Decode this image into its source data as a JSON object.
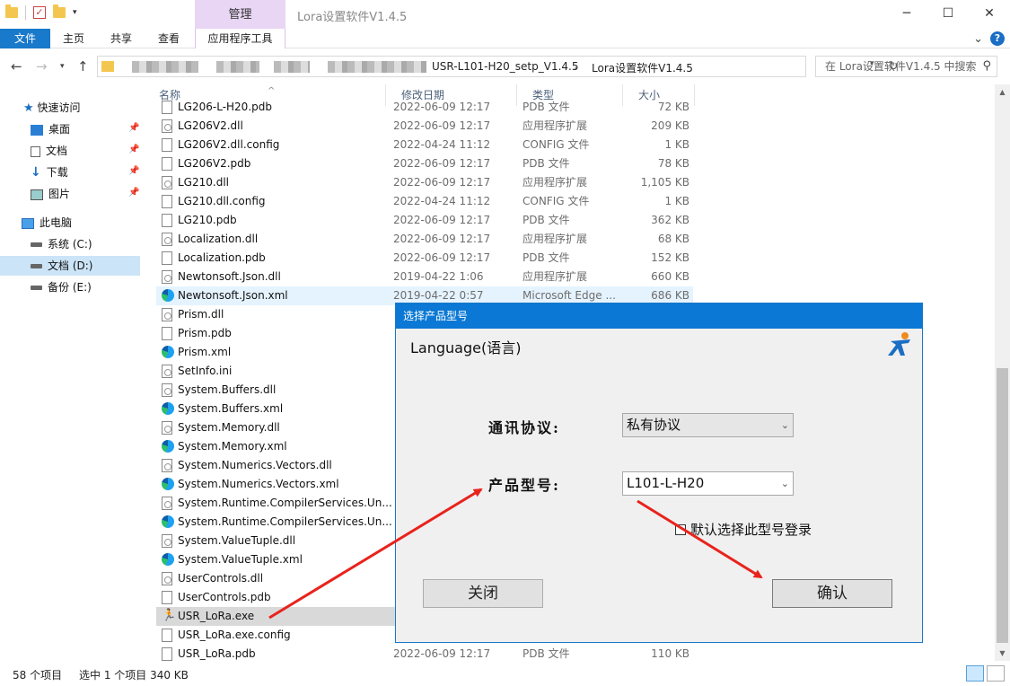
{
  "titlebar": {
    "manage_tab": "管理",
    "window_title": "Lora设置软件V1.4.5",
    "min": "─",
    "max": "☐",
    "close": "✕"
  },
  "ribbon": {
    "tabs": [
      "文件",
      "主页",
      "共享",
      "查看",
      "应用程序工具"
    ],
    "collapse": "⌄",
    "help": "?"
  },
  "address": {
    "crumbs": [
      "USR-L101-H20_setp_V1.4.5",
      "Lora设置软件V1.4.5"
    ],
    "sep": "›",
    "search_placeholder": "在 Lora设置软件V1.4.5 中搜索"
  },
  "nav": {
    "quick_access": "快速访问",
    "desktop": "桌面",
    "documents": "文档",
    "downloads": "下载",
    "pictures": "图片",
    "this_pc": "此电脑",
    "drive_c": "系统 (C:)",
    "drive_d": "文档 (D:)",
    "drive_e": "备份 (E:)"
  },
  "columns": {
    "name": "名称",
    "date": "修改日期",
    "type": "类型",
    "size": "大小"
  },
  "files": [
    {
      "name": "LG206-L-H20.pdb",
      "date": "2022-06-09 12:17",
      "type": "PDB 文件",
      "size": "72 KB",
      "icon": "doc"
    },
    {
      "name": "LG206V2.dll",
      "date": "2022-06-09 12:17",
      "type": "应用程序扩展",
      "size": "209 KB",
      "icon": "dll"
    },
    {
      "name": "LG206V2.dll.config",
      "date": "2022-04-24 11:12",
      "type": "CONFIG 文件",
      "size": "1 KB",
      "icon": "doc"
    },
    {
      "name": "LG206V2.pdb",
      "date": "2022-06-09 12:17",
      "type": "PDB 文件",
      "size": "78 KB",
      "icon": "doc"
    },
    {
      "name": "LG210.dll",
      "date": "2022-06-09 12:17",
      "type": "应用程序扩展",
      "size": "1,105 KB",
      "icon": "dll"
    },
    {
      "name": "LG210.dll.config",
      "date": "2022-04-24 11:12",
      "type": "CONFIG 文件",
      "size": "1 KB",
      "icon": "doc"
    },
    {
      "name": "LG210.pdb",
      "date": "2022-06-09 12:17",
      "type": "PDB 文件",
      "size": "362 KB",
      "icon": "doc"
    },
    {
      "name": "Localization.dll",
      "date": "2022-06-09 12:17",
      "type": "应用程序扩展",
      "size": "68 KB",
      "icon": "dll"
    },
    {
      "name": "Localization.pdb",
      "date": "2022-06-09 12:17",
      "type": "PDB 文件",
      "size": "152 KB",
      "icon": "doc"
    },
    {
      "name": "Newtonsoft.Json.dll",
      "date": "2019-04-22 1:06",
      "type": "应用程序扩展",
      "size": "660 KB",
      "icon": "dll"
    },
    {
      "name": "Newtonsoft.Json.xml",
      "date": "2019-04-22 0:57",
      "type": "Microsoft Edge ...",
      "size": "686 KB",
      "icon": "edge",
      "state": "hover"
    },
    {
      "name": "Prism.dll",
      "date": "",
      "type": "",
      "size": "",
      "icon": "dll"
    },
    {
      "name": "Prism.pdb",
      "date": "",
      "type": "",
      "size": "",
      "icon": "doc"
    },
    {
      "name": "Prism.xml",
      "date": "",
      "type": "",
      "size": "",
      "icon": "edge"
    },
    {
      "name": "SetInfo.ini",
      "date": "",
      "type": "",
      "size": "",
      "icon": "dll"
    },
    {
      "name": "System.Buffers.dll",
      "date": "",
      "type": "",
      "size": "",
      "icon": "dll"
    },
    {
      "name": "System.Buffers.xml",
      "date": "",
      "type": "",
      "size": "",
      "icon": "edge"
    },
    {
      "name": "System.Memory.dll",
      "date": "",
      "type": "",
      "size": "",
      "icon": "dll"
    },
    {
      "name": "System.Memory.xml",
      "date": "",
      "type": "",
      "size": "",
      "icon": "edge"
    },
    {
      "name": "System.Numerics.Vectors.dll",
      "date": "",
      "type": "",
      "size": "",
      "icon": "dll"
    },
    {
      "name": "System.Numerics.Vectors.xml",
      "date": "",
      "type": "",
      "size": "",
      "icon": "edge"
    },
    {
      "name": "System.Runtime.CompilerServices.Un...",
      "date": "",
      "type": "",
      "size": "",
      "icon": "dll"
    },
    {
      "name": "System.Runtime.CompilerServices.Un...",
      "date": "",
      "type": "",
      "size": "",
      "icon": "edge"
    },
    {
      "name": "System.ValueTuple.dll",
      "date": "",
      "type": "",
      "size": "",
      "icon": "dll"
    },
    {
      "name": "System.ValueTuple.xml",
      "date": "",
      "type": "",
      "size": "",
      "icon": "edge"
    },
    {
      "name": "UserControls.dll",
      "date": "",
      "type": "",
      "size": "",
      "icon": "dll"
    },
    {
      "name": "UserControls.pdb",
      "date": "",
      "type": "",
      "size": "",
      "icon": "doc"
    },
    {
      "name": "USR_LoRa.exe",
      "date": "",
      "type": "",
      "size": "",
      "icon": "exe",
      "state": "sel"
    },
    {
      "name": "USR_LoRa.exe.config",
      "date": "",
      "type": "",
      "size": "",
      "icon": "doc"
    },
    {
      "name": "USR_LoRa.pdb",
      "date": "2022-06-09 12:17",
      "type": "PDB 文件",
      "size": "110 KB",
      "icon": "doc"
    }
  ],
  "status": {
    "count": "58 个项目",
    "selected": "选中 1 个项目  340 KB"
  },
  "dialog": {
    "title": "选择产品型号",
    "language": "Language(语言)",
    "protocol_label": "通讯协议:",
    "protocol_value": "私有协议",
    "model_label": "产品型号:",
    "model_value": "L101-L-H20",
    "default_checkbox": "默认选择此型号登录",
    "close_button": "关闭",
    "confirm_button": "确认"
  },
  "colors": {
    "accent": "#0a78d4",
    "arrow": "#e8231c"
  }
}
